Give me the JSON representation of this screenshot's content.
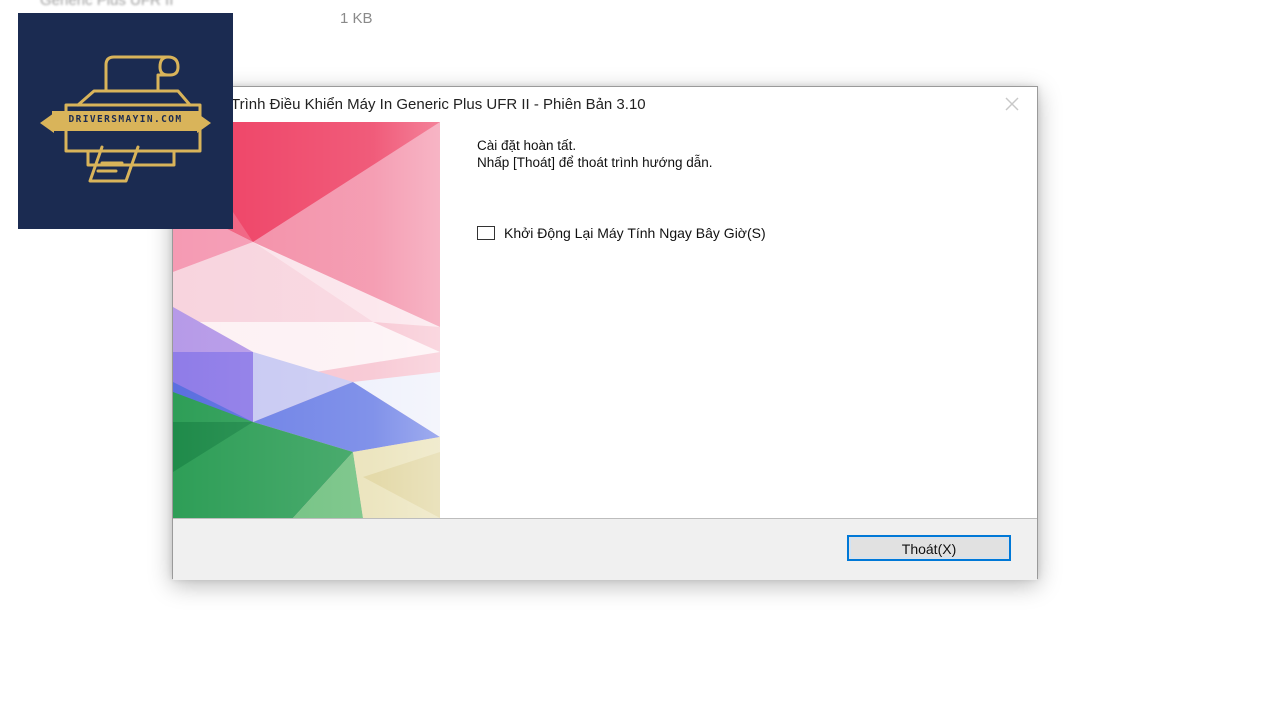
{
  "background": {
    "file_name": "Generic Plus UFR II",
    "file_size": "1 KB"
  },
  "dialog": {
    "title": "Trình Điều Khiển Máy In Generic Plus UFR II - Phiên Bản 3.10",
    "message_line1": "Cài đặt hoàn tất.",
    "message_line2": "Nhấp [Thoát] để thoát trình hướng dẫn.",
    "restart_checkbox": {
      "label": "Khởi Động Lại Máy Tính Ngay Bây Giờ(S)",
      "checked": false
    },
    "exit_button": "Thoát(X)",
    "close_icon": "close-icon",
    "accent_color": "#0078d7"
  },
  "watermark": {
    "text": "DRIVERSMAYIN.COM",
    "icon": "printer-icon",
    "bg_color": "#1b2b51",
    "fg_color": "#d9b45a"
  }
}
